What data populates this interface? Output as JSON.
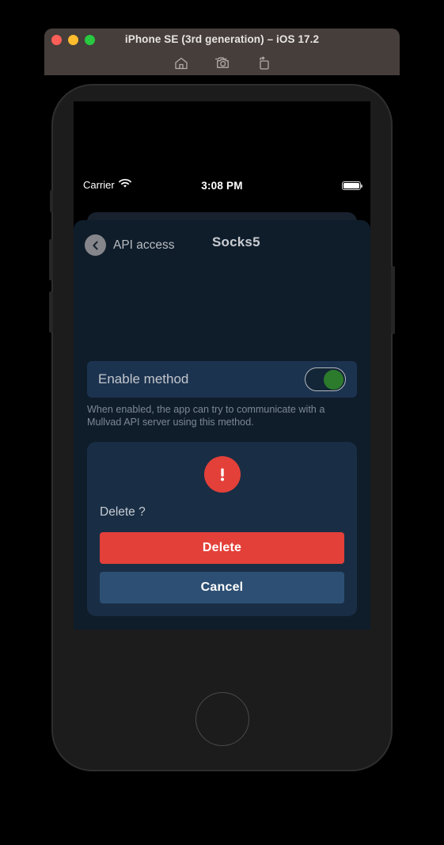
{
  "window": {
    "title": "iPhone SE (3rd generation) – iOS 17.2",
    "traffic_lights": [
      {
        "name": "close",
        "color": "#ff5f57"
      },
      {
        "name": "minimize",
        "color": "#febc2e"
      },
      {
        "name": "maximize",
        "color": "#28c840"
      }
    ],
    "toolbar": [
      {
        "icon": "home-icon",
        "label": "Home"
      },
      {
        "icon": "screenshot-icon",
        "label": "Screenshot"
      },
      {
        "icon": "rotate-icon",
        "label": "Rotate"
      }
    ]
  },
  "status_bar": {
    "carrier": "Carrier",
    "wifi_icon": "wifi-icon",
    "time": "3:08 PM",
    "battery_icon": "battery-icon",
    "battery_level": "100"
  },
  "nav": {
    "back_icon": "chevron-left-icon",
    "back_label": "API access",
    "title": "Socks5"
  },
  "settings": {
    "toggle_label": "Enable method",
    "toggle_on": true,
    "footer": "When enabled, the app can try to communicate with a Mullvad API server using this method."
  },
  "alert": {
    "icon": "alert-exclamation-icon",
    "message": "Delete ?",
    "primary_label": "Delete",
    "secondary_label": "Cancel"
  },
  "device": {
    "home_button": "home-button"
  },
  "colors": {
    "accent_red": "#e34039",
    "accent_blue": "#2d4f73",
    "toggle_green": "#2c7b2c",
    "sheet_bg": "#0f1d2b",
    "row_bg": "#1c3350",
    "alert_bg": "#192e45"
  }
}
